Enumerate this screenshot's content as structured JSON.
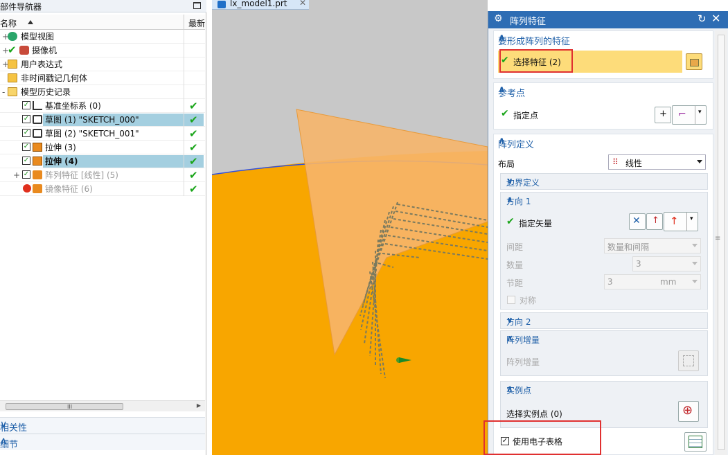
{
  "nav": {
    "title": "部件导航器",
    "col_name": "名称",
    "col_latest": "最新",
    "rows": [
      {
        "label": "模型视图"
      },
      {
        "label": "摄像机"
      },
      {
        "label": "用户表达式"
      },
      {
        "label": "非时间戳记几何体"
      },
      {
        "label": "模型历史记录"
      },
      {
        "label": "基准坐标系 (0)"
      },
      {
        "label": "草图 (1) \"SKETCH_000\""
      },
      {
        "label": "草图 (2) \"SKETCH_001\""
      },
      {
        "label": "拉伸 (3)"
      },
      {
        "label": "拉伸 (4)"
      },
      {
        "label": "阵列特征 [线性] (5)"
      },
      {
        "label": "镜像特征 (6)"
      }
    ],
    "scroll_grip": "III",
    "panel_relations": "相关性",
    "panel_details": "细节"
  },
  "tab": {
    "label": "lx_model1.prt"
  },
  "dialog": {
    "title": "阵列特征",
    "sec_features": {
      "title": "要形成阵列的特征",
      "select": "选择特征 (2)"
    },
    "sec_ref": {
      "title": "参考点",
      "point": "指定点"
    },
    "sec_def": {
      "title": "阵列定义",
      "layout_label": "布局",
      "layout_value": "线性",
      "boundary": "边界定义",
      "dir1": {
        "title": "方向 1",
        "vector": "指定矢量",
        "spacing_label": "间距",
        "spacing_value": "数量和间隔",
        "count_label": "数量",
        "count_value": "3",
        "pitch_label": "节距",
        "pitch_value": "3",
        "pitch_unit": "mm",
        "symmetric": "对称"
      },
      "dir2": {
        "title": "方向 2"
      },
      "increment": {
        "title": "阵列增量",
        "label": "阵列增量"
      },
      "instance": {
        "title": "实例点",
        "select": "选择实例点 (0)"
      }
    },
    "spreadsheet": "使用电子表格"
  }
}
